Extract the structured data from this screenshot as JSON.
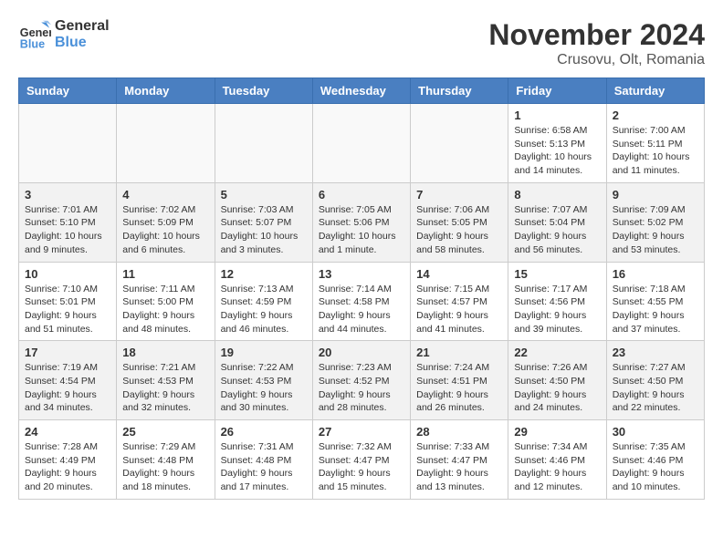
{
  "logo": {
    "line1": "General",
    "line2": "Blue"
  },
  "title": "November 2024",
  "subtitle": "Crusovu, Olt, Romania",
  "days_of_week": [
    "Sunday",
    "Monday",
    "Tuesday",
    "Wednesday",
    "Thursday",
    "Friday",
    "Saturday"
  ],
  "weeks": [
    [
      {
        "day": "",
        "info": ""
      },
      {
        "day": "",
        "info": ""
      },
      {
        "day": "",
        "info": ""
      },
      {
        "day": "",
        "info": ""
      },
      {
        "day": "",
        "info": ""
      },
      {
        "day": "1",
        "info": "Sunrise: 6:58 AM\nSunset: 5:13 PM\nDaylight: 10 hours and 14 minutes."
      },
      {
        "day": "2",
        "info": "Sunrise: 7:00 AM\nSunset: 5:11 PM\nDaylight: 10 hours and 11 minutes."
      }
    ],
    [
      {
        "day": "3",
        "info": "Sunrise: 7:01 AM\nSunset: 5:10 PM\nDaylight: 10 hours and 9 minutes."
      },
      {
        "day": "4",
        "info": "Sunrise: 7:02 AM\nSunset: 5:09 PM\nDaylight: 10 hours and 6 minutes."
      },
      {
        "day": "5",
        "info": "Sunrise: 7:03 AM\nSunset: 5:07 PM\nDaylight: 10 hours and 3 minutes."
      },
      {
        "day": "6",
        "info": "Sunrise: 7:05 AM\nSunset: 5:06 PM\nDaylight: 10 hours and 1 minute."
      },
      {
        "day": "7",
        "info": "Sunrise: 7:06 AM\nSunset: 5:05 PM\nDaylight: 9 hours and 58 minutes."
      },
      {
        "day": "8",
        "info": "Sunrise: 7:07 AM\nSunset: 5:04 PM\nDaylight: 9 hours and 56 minutes."
      },
      {
        "day": "9",
        "info": "Sunrise: 7:09 AM\nSunset: 5:02 PM\nDaylight: 9 hours and 53 minutes."
      }
    ],
    [
      {
        "day": "10",
        "info": "Sunrise: 7:10 AM\nSunset: 5:01 PM\nDaylight: 9 hours and 51 minutes."
      },
      {
        "day": "11",
        "info": "Sunrise: 7:11 AM\nSunset: 5:00 PM\nDaylight: 9 hours and 48 minutes."
      },
      {
        "day": "12",
        "info": "Sunrise: 7:13 AM\nSunset: 4:59 PM\nDaylight: 9 hours and 46 minutes."
      },
      {
        "day": "13",
        "info": "Sunrise: 7:14 AM\nSunset: 4:58 PM\nDaylight: 9 hours and 44 minutes."
      },
      {
        "day": "14",
        "info": "Sunrise: 7:15 AM\nSunset: 4:57 PM\nDaylight: 9 hours and 41 minutes."
      },
      {
        "day": "15",
        "info": "Sunrise: 7:17 AM\nSunset: 4:56 PM\nDaylight: 9 hours and 39 minutes."
      },
      {
        "day": "16",
        "info": "Sunrise: 7:18 AM\nSunset: 4:55 PM\nDaylight: 9 hours and 37 minutes."
      }
    ],
    [
      {
        "day": "17",
        "info": "Sunrise: 7:19 AM\nSunset: 4:54 PM\nDaylight: 9 hours and 34 minutes."
      },
      {
        "day": "18",
        "info": "Sunrise: 7:21 AM\nSunset: 4:53 PM\nDaylight: 9 hours and 32 minutes."
      },
      {
        "day": "19",
        "info": "Sunrise: 7:22 AM\nSunset: 4:53 PM\nDaylight: 9 hours and 30 minutes."
      },
      {
        "day": "20",
        "info": "Sunrise: 7:23 AM\nSunset: 4:52 PM\nDaylight: 9 hours and 28 minutes."
      },
      {
        "day": "21",
        "info": "Sunrise: 7:24 AM\nSunset: 4:51 PM\nDaylight: 9 hours and 26 minutes."
      },
      {
        "day": "22",
        "info": "Sunrise: 7:26 AM\nSunset: 4:50 PM\nDaylight: 9 hours and 24 minutes."
      },
      {
        "day": "23",
        "info": "Sunrise: 7:27 AM\nSunset: 4:50 PM\nDaylight: 9 hours and 22 minutes."
      }
    ],
    [
      {
        "day": "24",
        "info": "Sunrise: 7:28 AM\nSunset: 4:49 PM\nDaylight: 9 hours and 20 minutes."
      },
      {
        "day": "25",
        "info": "Sunrise: 7:29 AM\nSunset: 4:48 PM\nDaylight: 9 hours and 18 minutes."
      },
      {
        "day": "26",
        "info": "Sunrise: 7:31 AM\nSunset: 4:48 PM\nDaylight: 9 hours and 17 minutes."
      },
      {
        "day": "27",
        "info": "Sunrise: 7:32 AM\nSunset: 4:47 PM\nDaylight: 9 hours and 15 minutes."
      },
      {
        "day": "28",
        "info": "Sunrise: 7:33 AM\nSunset: 4:47 PM\nDaylight: 9 hours and 13 minutes."
      },
      {
        "day": "29",
        "info": "Sunrise: 7:34 AM\nSunset: 4:46 PM\nDaylight: 9 hours and 12 minutes."
      },
      {
        "day": "30",
        "info": "Sunrise: 7:35 AM\nSunset: 4:46 PM\nDaylight: 9 hours and 10 minutes."
      }
    ]
  ]
}
